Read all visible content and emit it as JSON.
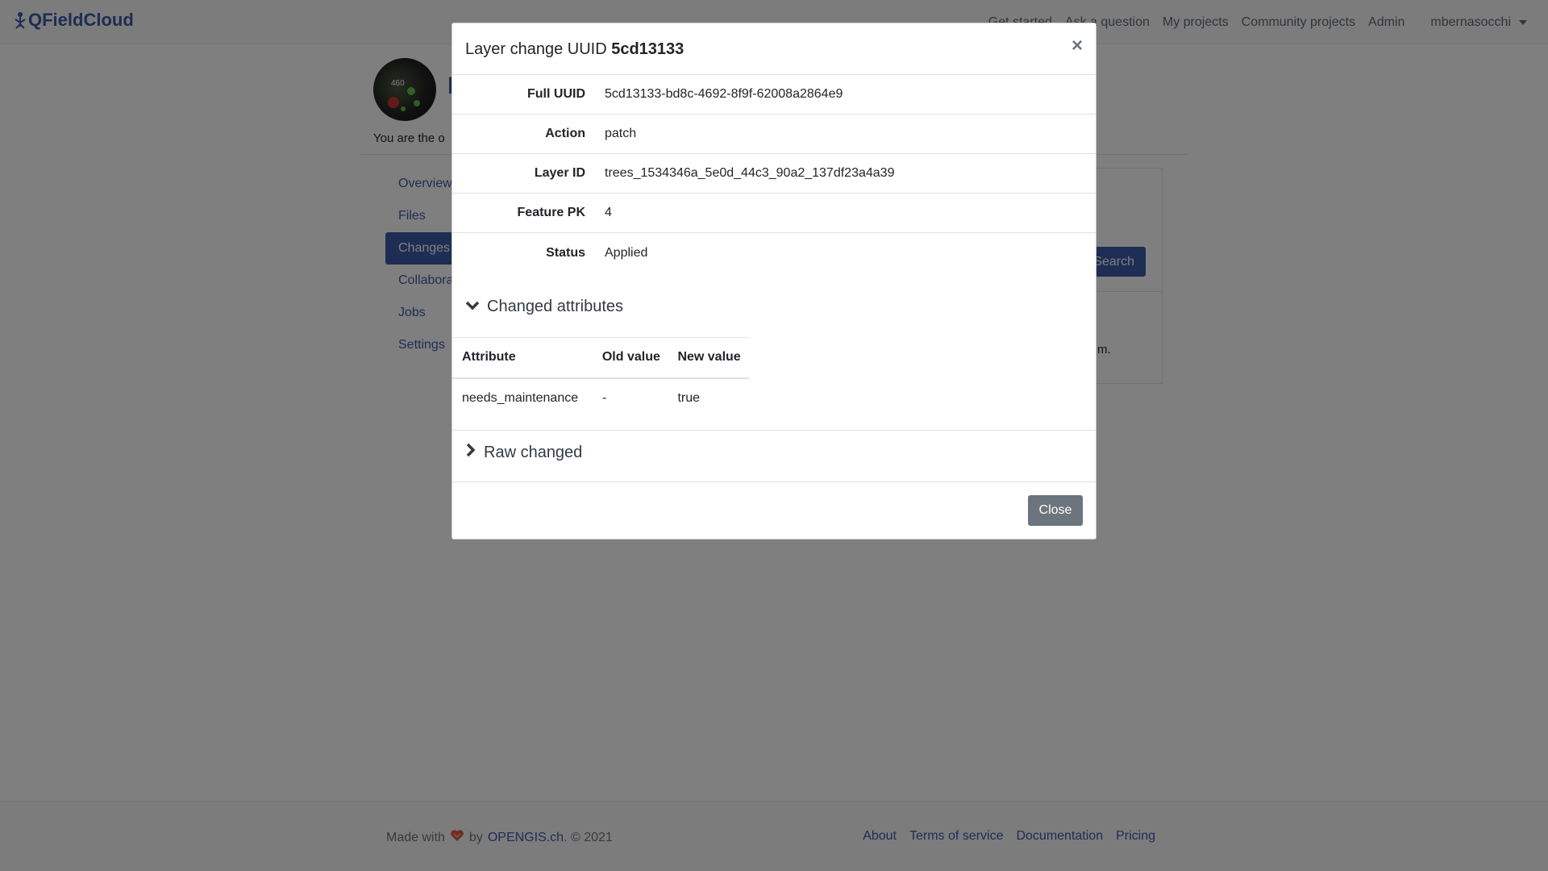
{
  "navbar": {
    "brand": "QFieldCloud",
    "links": [
      "Get started",
      "Ask a question",
      "My projects",
      "Community projects",
      "Admin"
    ],
    "user": "mbernasocchi"
  },
  "project": {
    "avatar_count": "460",
    "title_initial": "I",
    "owner_text": "You are the o"
  },
  "sidebar": {
    "items": [
      {
        "label": "Overview",
        "active": false
      },
      {
        "label": "Files",
        "active": false
      },
      {
        "label": "Changes",
        "active": true
      },
      {
        "label": "Collabora",
        "active": false
      },
      {
        "label": "Jobs",
        "active": false
      },
      {
        "label": "Settings",
        "active": false
      }
    ]
  },
  "content": {
    "search_label": "Search",
    "trail_text": "m."
  },
  "footer": {
    "made_with": "Made with",
    "by": "by",
    "company": "OPENGIS.ch",
    "copyright": ". © 2021",
    "links": [
      "About",
      "Terms of service",
      "Documentation",
      "Pricing"
    ]
  },
  "modal": {
    "title_prefix": "Layer change UUID",
    "title_uuid": "5cd13133",
    "close_symbol": "×",
    "fields": [
      {
        "label": "Full UUID",
        "value": "5cd13133-bd8c-4692-8f9f-62008a2864e9"
      },
      {
        "label": "Action",
        "value": "patch"
      },
      {
        "label": "Layer ID",
        "value": "trees_1534346a_5e0d_44c3_90a2_137df23a4a39"
      },
      {
        "label": "Feature PK",
        "value": "4"
      },
      {
        "label": "Status",
        "value": "Applied"
      }
    ],
    "changed_attributes_label": "Changed attributes",
    "table_headers": [
      "Attribute",
      "Old value",
      "New value"
    ],
    "table_rows": [
      [
        "needs_maintenance",
        "-",
        "true"
      ]
    ],
    "raw_changed_label": "Raw changed",
    "close_button": "Close"
  },
  "colors": {
    "accent": "#3c5aa6",
    "backdrop": "rgba(0,0,0,0.5)",
    "close_button": "#6c757d"
  }
}
